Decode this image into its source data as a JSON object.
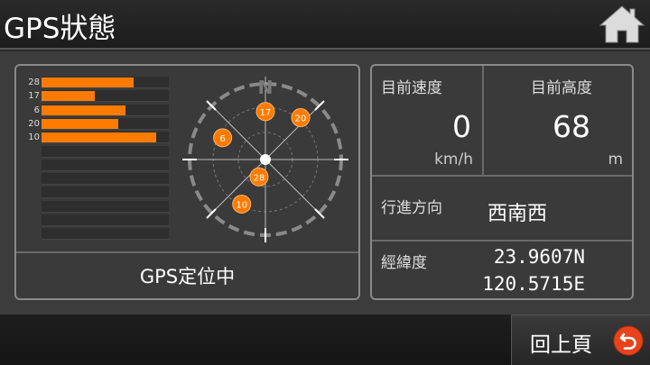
{
  "header": {
    "title": "GPS狀態"
  },
  "satellites": [
    {
      "id": "28",
      "strength": 0.72,
      "az": 200,
      "el": 68
    },
    {
      "id": "17",
      "strength": 0.42,
      "az": 0,
      "el": 33
    },
    {
      "id": "6",
      "strength": 0.66,
      "az": 297,
      "el": 33
    },
    {
      "id": "20",
      "strength": 0.6,
      "az": 40,
      "el": 25
    },
    {
      "id": "10",
      "strength": 0.9,
      "az": 208,
      "el": 30
    }
  ],
  "bar_slots": 12,
  "compass": {
    "north_label": "N"
  },
  "status": {
    "text": "GPS定位中"
  },
  "speed": {
    "label": "目前速度",
    "value": "0",
    "unit": "km/h"
  },
  "altitude": {
    "label": "目前高度",
    "value": "68",
    "unit": "m"
  },
  "heading": {
    "label": "行進方向",
    "value": "西南西"
  },
  "coords": {
    "label": "經緯度",
    "lat": "23.9607N",
    "lon": "120.5715E"
  },
  "footer": {
    "back_label": "回上頁"
  },
  "colors": {
    "accent": "#ff7b00",
    "back_icon": "#e8431c"
  }
}
